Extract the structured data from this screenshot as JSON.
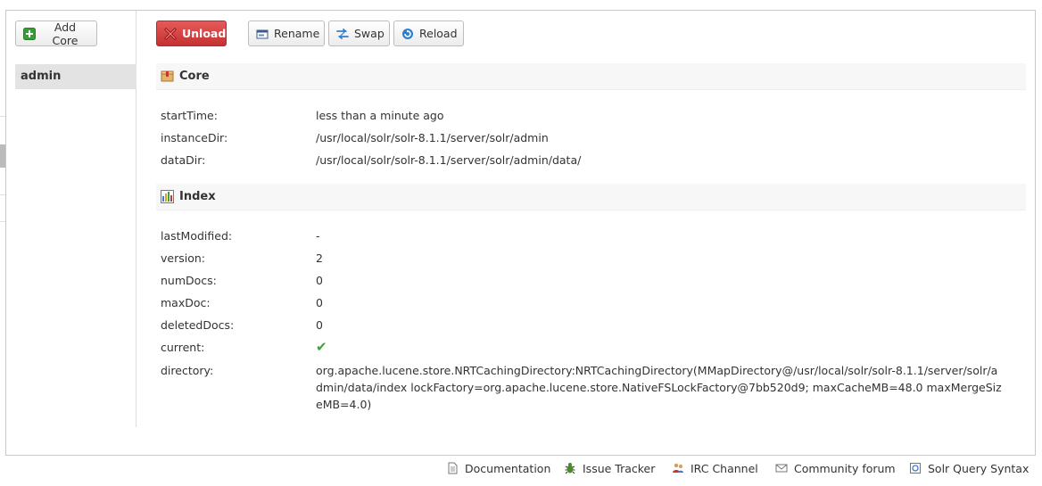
{
  "toolbar": {
    "add_core": "Add Core",
    "unload": "Unload",
    "rename": "Rename",
    "swap": "Swap",
    "reload": "Reload"
  },
  "cores": [
    "admin"
  ],
  "sections": {
    "core": "Core",
    "index": "Index"
  },
  "core_info": [
    {
      "key": "startTime:",
      "value": "less than a minute ago"
    },
    {
      "key": "instanceDir:",
      "value": "/usr/local/solr/solr-8.1.1/server/solr/admin"
    },
    {
      "key": "dataDir:",
      "value": "/usr/local/solr/solr-8.1.1/server/solr/admin/data/"
    }
  ],
  "index_info": [
    {
      "key": "lastModified:",
      "value": "-"
    },
    {
      "key": "version:",
      "value": "2"
    },
    {
      "key": "numDocs:",
      "value": "0"
    },
    {
      "key": "maxDoc:",
      "value": "0"
    },
    {
      "key": "deletedDocs:",
      "value": "0"
    },
    {
      "key": "current:",
      "value": "✔"
    },
    {
      "key": "directory:",
      "value": "org.apache.lucene.store.NRTCachingDirectory:NRTCachingDirectory(MMapDirectory@/usr/local/solr/solr-8.1.1/server/solr/admin/data/index lockFactory=org.apache.lucene.store.NativeFSLockFactory@7bb520d9; maxCacheMB=48.0 maxMergeSizeMB=4.0)"
    }
  ],
  "footer": {
    "documentation": "Documentation",
    "issue_tracker": "Issue Tracker",
    "irc_channel": "IRC Channel",
    "community_forum": "Community forum",
    "query_syntax": "Solr Query Syntax"
  },
  "colors": {
    "unload_bg": "#d64040",
    "check_green": "#3aa43a",
    "add_green": "#3a9b3a"
  },
  "icons": {
    "add_core": "add-green-plus-icon",
    "unload": "red-x-icon",
    "rename": "rename-window-icon",
    "swap": "swap-arrows-icon",
    "reload": "reload-circle-icon",
    "core": "box-icon",
    "index": "bar-chart-icon",
    "current": "check-icon"
  }
}
